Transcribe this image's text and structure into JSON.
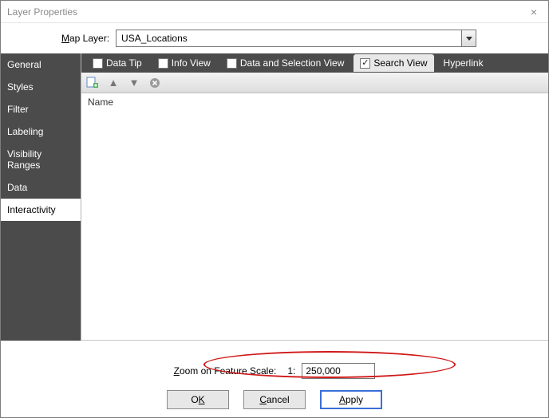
{
  "window": {
    "title": "Layer Properties"
  },
  "mapLayer": {
    "label_pre": "M",
    "label_rest": "ap Layer:",
    "value": "USA_Locations"
  },
  "sidebar": {
    "items": [
      {
        "label": "General"
      },
      {
        "label": "Styles"
      },
      {
        "label": "Filter"
      },
      {
        "label": "Labeling"
      },
      {
        "label": "Visibility Ranges"
      },
      {
        "label": "Data"
      },
      {
        "label": "Interactivity"
      }
    ],
    "active_index": 6
  },
  "tabs": {
    "data_tip": "Data Tip",
    "info_view": "Info View",
    "data_sel_view": "Data and Selection View",
    "search_view": "Search View",
    "hyperlink": "Hyperlink"
  },
  "list": {
    "header": "Name"
  },
  "zoom": {
    "label_pre": "Z",
    "label_rest": "oom on Feature Scale:",
    "ratio_prefix": "1:",
    "value": "250,000"
  },
  "buttons": {
    "ok_pre": "O",
    "ok_u": "K",
    "cancel_u": "C",
    "cancel_rest": "ancel",
    "apply_u": "A",
    "apply_rest": "pply"
  }
}
